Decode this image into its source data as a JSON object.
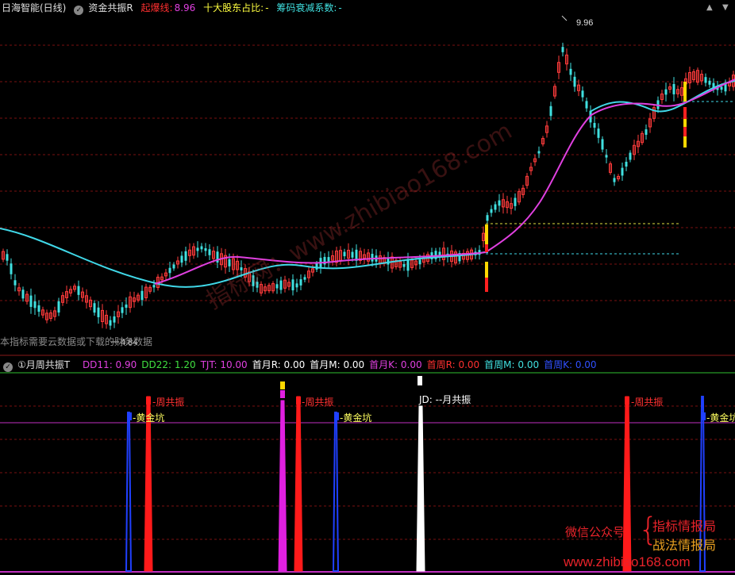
{
  "top": {
    "app_name": "日海智能(日线)",
    "indicator": "资金共振R",
    "qibao_label": "起爆线:",
    "qibao_value": "8.96",
    "shareholder_label": "十大股东占比:",
    "shareholder_value": "-",
    "chip_label": "筹码衰减系数:",
    "chip_value": "-"
  },
  "price_chart": {
    "high_label": "9.96",
    "low_label": "4.84",
    "notice": "本指标需要云数据或下载的财务数据"
  },
  "sub": {
    "title": "月周共振T",
    "params": [
      {
        "text": "DD11: 0.90",
        "color": "#e040e0"
      },
      {
        "text": "DD22: 1.20",
        "color": "#40e040"
      },
      {
        "text": "TJT: 10.00",
        "color": "#e040e0"
      },
      {
        "text": "首月R: 0.00",
        "color": "#ffffff"
      },
      {
        "text": "首月M: 0.00",
        "color": "#ffffff"
      },
      {
        "text": "首月K: 0.00",
        "color": "#e040e0"
      },
      {
        "text": "首周R: 0.00",
        "color": "#ff3030"
      },
      {
        "text": "首周M: 0.00",
        "color": "#40e0e0"
      },
      {
        "text": "首周K: 0.00",
        "color": "#3050ff"
      }
    ],
    "labels": {
      "week_resonance": "周共振",
      "golden_pit": "黄金坑",
      "month_resonance": "JD: --月共振"
    }
  },
  "brand": {
    "wechat": "微信公众号",
    "line1": "指标情报局",
    "line2": "战法情报局",
    "url": "www.zhibiao168.com",
    "watermark": "指标网：www.zhibiao168.com"
  },
  "colors": {
    "up": "#ff3b3b",
    "down": "#40e0e0",
    "ma": "#e040e0",
    "slow_ma": "#40d8e8",
    "grid": "#7a1010"
  }
}
